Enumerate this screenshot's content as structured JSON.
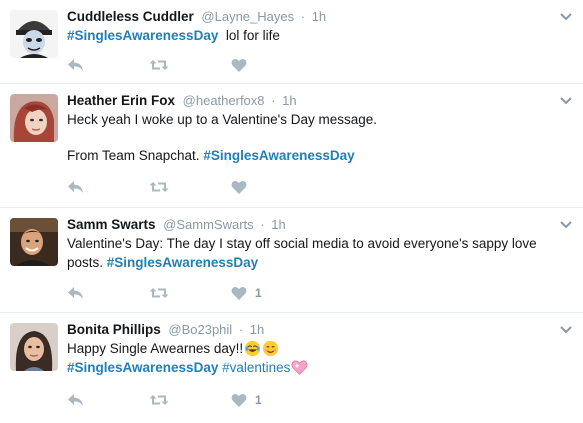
{
  "tweets": [
    {
      "fullname": "Cuddleless Cuddler",
      "username": "@Layne_Hayes",
      "time": "1h",
      "paragraphs": [
        [
          {
            "type": "hashtag",
            "text": "#SinglesAwarenessDay"
          },
          {
            "type": "text",
            "text": "  lol for life"
          }
        ]
      ],
      "like_count": ""
    },
    {
      "fullname": "Heather Erin Fox",
      "username": "@heatherfox8",
      "time": "1h",
      "paragraphs": [
        [
          {
            "type": "text",
            "text": "Heck yeah I woke up to a Valentine's Day message."
          }
        ],
        [
          {
            "type": "text",
            "text": "From Team Snapchat. "
          },
          {
            "type": "hashtag",
            "text": "#SinglesAwarenessDay"
          }
        ]
      ],
      "like_count": ""
    },
    {
      "fullname": "Samm Swarts",
      "username": "@SammSwarts",
      "time": "1h",
      "paragraphs": [
        [
          {
            "type": "text",
            "text": "Valentine's Day: The day I stay off social media to avoid everyone's sappy love posts. "
          },
          {
            "type": "hashtag",
            "text": "#SinglesAwarenessDay"
          }
        ]
      ],
      "like_count": "1"
    },
    {
      "fullname": "Bonita Phillips",
      "username": "@Bo23phil",
      "time": "1h",
      "paragraphs": [
        [
          {
            "type": "text",
            "text": "Happy Single Awearnes day!!"
          },
          {
            "type": "emoji",
            "name": "tears-of-joy-emoji-icon"
          },
          {
            "type": "emoji",
            "name": "smiling-face-emoji-icon"
          }
        ],
        [
          {
            "type": "hashtag",
            "text": "#SinglesAwarenessDay"
          },
          {
            "type": "text",
            "text": " "
          },
          {
            "type": "hashtag",
            "text": "#valentines"
          },
          {
            "type": "emoji",
            "name": "sparkling-heart-emoji-icon"
          }
        ]
      ],
      "like_count": "1"
    }
  ],
  "colors": {
    "hashtag": "#1f7fb6",
    "meta": "#8899a6",
    "action_icon": "#aab8c2",
    "divider": "#e6ecf0"
  },
  "icons": [
    "reply-icon",
    "retweet-icon",
    "like-icon",
    "chevron-down-icon"
  ]
}
